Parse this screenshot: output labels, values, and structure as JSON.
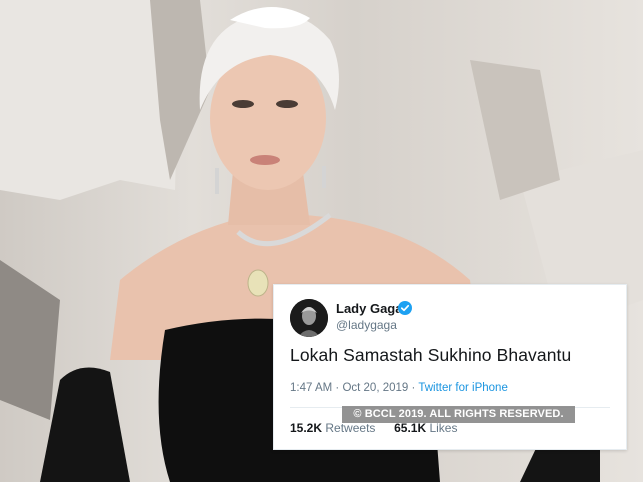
{
  "tweet": {
    "author_name": "Lady Gaga",
    "handle": "@ladygaga",
    "text": "Lokah Samastah Sukhino Bhavantu",
    "time": "1:47 AM",
    "separator": "·",
    "date": "Oct 20, 2019",
    "source": "Twitter for iPhone",
    "retweets_count": "15.2K",
    "retweets_label": "Retweets",
    "likes_count": "65.1K",
    "likes_label": "Likes"
  },
  "watermark": {
    "text": "© BCCL 2019. ALL RIGHTS RESERVED."
  },
  "colors": {
    "verified": "#1da1f2",
    "link": "#1b95e0",
    "muted": "#657786"
  },
  "icons": {
    "verified": "verified-badge-icon"
  }
}
